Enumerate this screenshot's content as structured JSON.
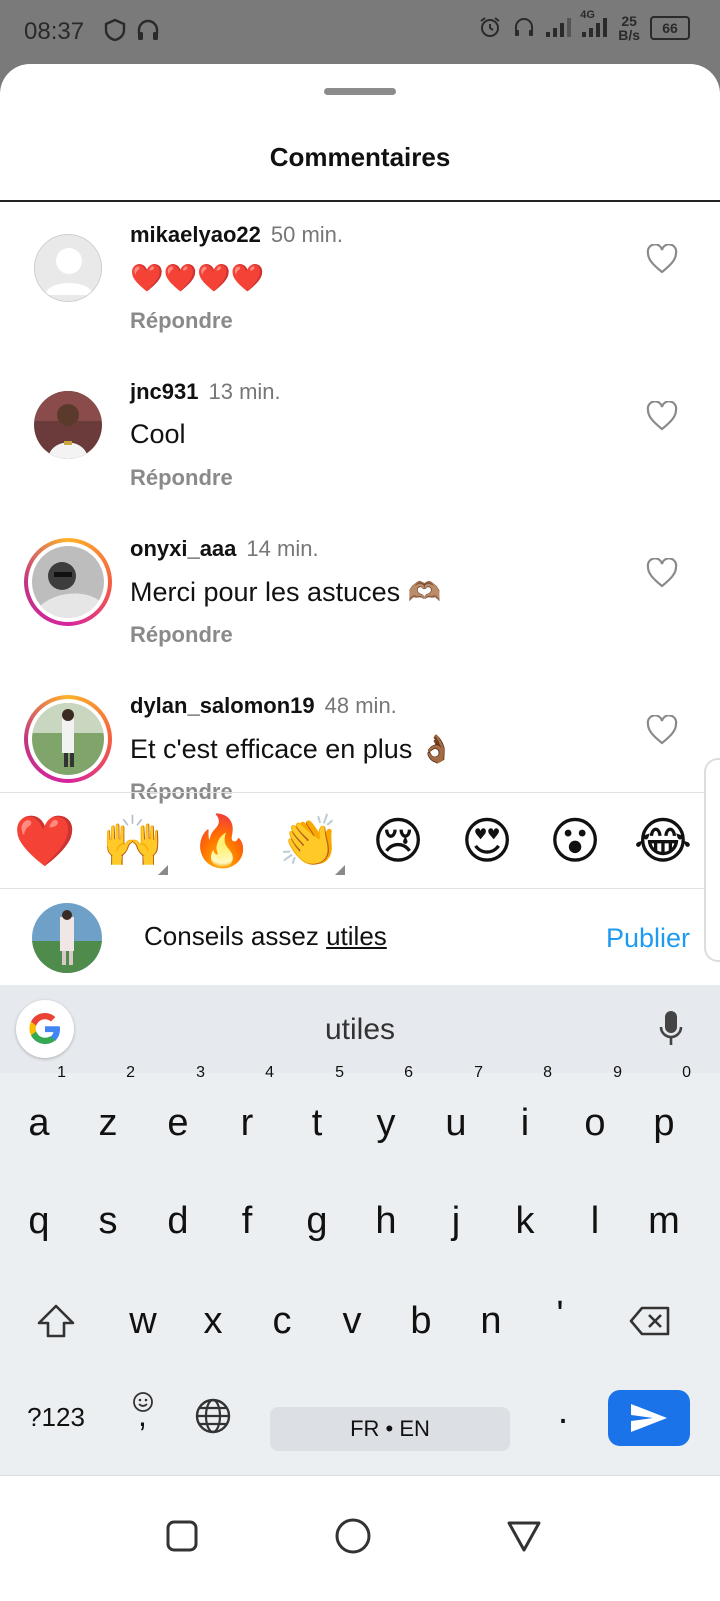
{
  "status_bar": {
    "time": "08:37",
    "network": "4G",
    "speed": "25",
    "speed_unit": "B/s",
    "battery": "66"
  },
  "sheet": {
    "title": "Commentaires"
  },
  "comments": [
    {
      "username": "mikaelyao22",
      "time": "50 min.",
      "text": "❤️❤️❤️❤️",
      "reply_label": "Répondre",
      "avatar": "default-avatar"
    },
    {
      "username": "jnc931",
      "time": "13 min.",
      "text": "Cool",
      "reply_label": "Répondre",
      "avatar": "photo"
    },
    {
      "username": "onyxi_aaa",
      "time": "14 min.",
      "text": "Merci pour les astuces 🫶🏽",
      "reply_label": "Répondre",
      "avatar": "story-ring"
    },
    {
      "username": "dylan_salomon19",
      "time": "48 min.",
      "text": "Et c'est efficace en plus 👌🏾",
      "reply_label": "Répondre",
      "avatar": "story-ring"
    }
  ],
  "emoji_bar": [
    "❤️",
    "🙌",
    "🔥",
    "👏",
    "😢",
    "😍",
    "😮",
    "😂"
  ],
  "composer": {
    "text_before": "Conseils assez ",
    "text_underlined": "utiles",
    "publish_label": "Publier"
  },
  "keyboard": {
    "suggestion": "utiles",
    "row1": [
      {
        "key": "a",
        "hint": "1"
      },
      {
        "key": "z",
        "hint": "2"
      },
      {
        "key": "e",
        "hint": "3"
      },
      {
        "key": "r",
        "hint": "4"
      },
      {
        "key": "t",
        "hint": "5"
      },
      {
        "key": "y",
        "hint": "6"
      },
      {
        "key": "u",
        "hint": "7"
      },
      {
        "key": "i",
        "hint": "8"
      },
      {
        "key": "o",
        "hint": "9"
      },
      {
        "key": "p",
        "hint": "0"
      }
    ],
    "row2": [
      "q",
      "s",
      "d",
      "f",
      "g",
      "h",
      "j",
      "k",
      "l",
      "m"
    ],
    "row3": [
      "w",
      "x",
      "c",
      "v",
      "b",
      "n",
      "'"
    ],
    "symbols_label": "?123",
    "comma": ",",
    "period": ".",
    "space_label": "FR • EN"
  },
  "colors": {
    "accent": "#1e9bf0",
    "enter_key": "#1a73e8",
    "story_ring": "#d6249f"
  }
}
